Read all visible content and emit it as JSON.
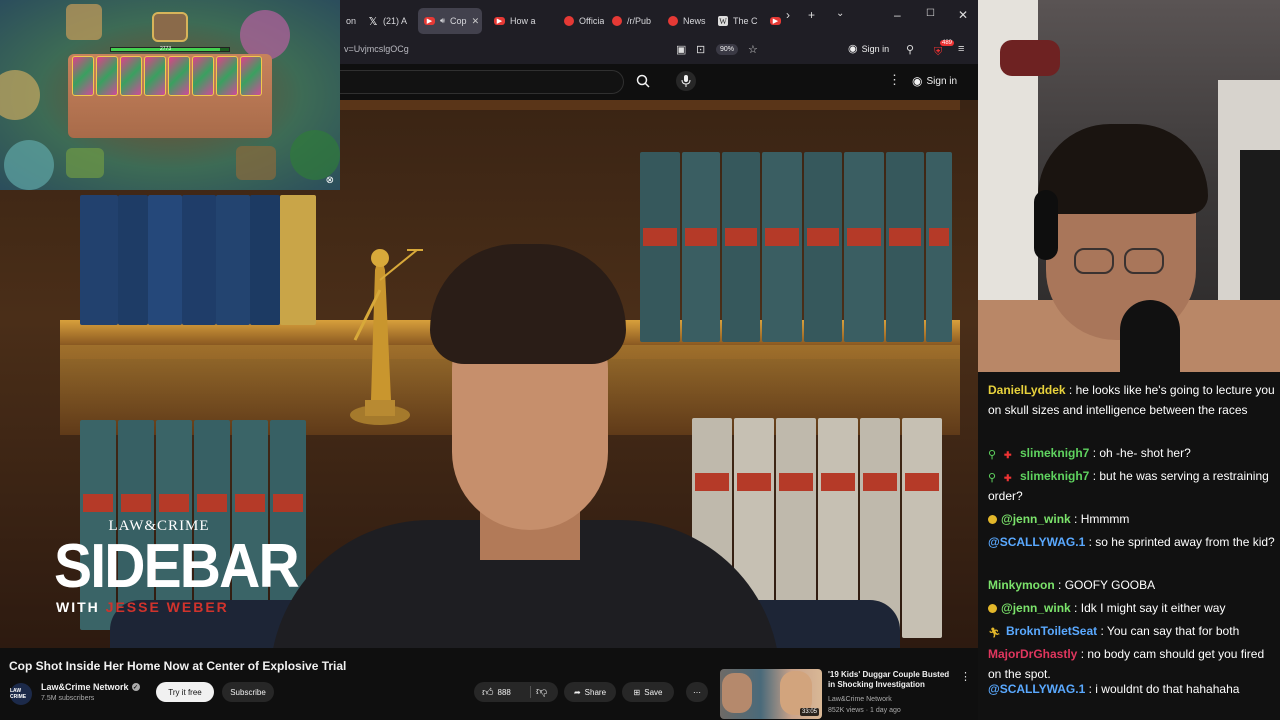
{
  "browser": {
    "tabs": [
      {
        "label": "on",
        "icon": "partial-tab-icon",
        "active": false
      },
      {
        "label": "(21) A",
        "icon": "x-logo-icon",
        "active": false
      },
      {
        "label": "Cop",
        "icon": "youtube-icon",
        "active": true
      },
      {
        "label": "How a",
        "icon": "youtube-icon",
        "active": false
      },
      {
        "label": "Officia",
        "icon": "reddit-icon",
        "active": false
      },
      {
        "label": "/r/Pub",
        "icon": "reddit-icon",
        "active": false
      },
      {
        "label": "News",
        "icon": "reddit-icon",
        "active": false
      },
      {
        "label": "The C",
        "icon": "wikipedia-icon",
        "active": false
      }
    ],
    "url": "v=UvjmcslgOCg",
    "zoom": "90%",
    "sign_in": "Sign in",
    "ext_badge": "489"
  },
  "yt_header": {
    "sign_in": "Sign in"
  },
  "video_overlay": {
    "brand": "LAW&CRIME",
    "show": "SIDEBAR",
    "with_prefix": "WITH ",
    "host": "JESSE WEBER"
  },
  "game": {
    "hp": "2773"
  },
  "video": {
    "title": "Cop Shot Inside Her Home Now at Center of Explosive Trial",
    "channel": "Law&Crime Network",
    "channel_avatar_text": "LAW CRIME",
    "subscribers": "7.5M subscribers",
    "try_free": "Try it free",
    "subscribe": "Subscribe",
    "likes": "888",
    "share": "Share",
    "save": "Save"
  },
  "recommended": {
    "title": "'19 Kids' Duggar Couple Busted in Shocking Investigation",
    "channel": "Law&Crime Network",
    "meta": "852K views · 1 day ago",
    "duration": "33:05"
  },
  "chat": [
    {
      "user": "DanielLyddek",
      "color": "#e8d23c",
      "badges": [],
      "text": "he looks like he's going to lecture you on skull sizes and intelligence between the races"
    },
    {
      "user": "slimeknigh7",
      "color": "#5fd35f",
      "badges": [
        "person",
        "gift"
      ],
      "text": "oh -he- shot her?"
    },
    {
      "user": "slimeknigh7",
      "color": "#5fd35f",
      "badges": [
        "person",
        "gift"
      ],
      "text": "but he was serving a restraining order?"
    },
    {
      "user": "@jenn_wink",
      "color": "#7be36b",
      "badges": [
        "coin"
      ],
      "text": "Hmmmm"
    },
    {
      "user": "@SCALLYWAG.1",
      "color": "#5aa9ff",
      "badges": [],
      "text": "so he sprinted away from the kid?"
    },
    {
      "user": "Minkymoon",
      "color": "#7be36b",
      "badges": [],
      "text": "GOOFY GOOBA"
    },
    {
      "user": "@jenn_wink",
      "color": "#7be36b",
      "badges": [
        "coin"
      ],
      "text": "Idk I might say it either way"
    },
    {
      "user": "BroknToiletSeat",
      "color": "#5aa9ff",
      "badges": [
        "runner"
      ],
      "text": "You can say that for both"
    },
    {
      "user": "MajorDrGhastly",
      "color": "#e0365e",
      "badges": [],
      "text": "no body cam should get you fired on the spot."
    },
    {
      "user": "@SCALLYWAG.1",
      "color": "#5aa9ff",
      "badges": [],
      "text": "i wouldnt do that hahahaha"
    }
  ]
}
